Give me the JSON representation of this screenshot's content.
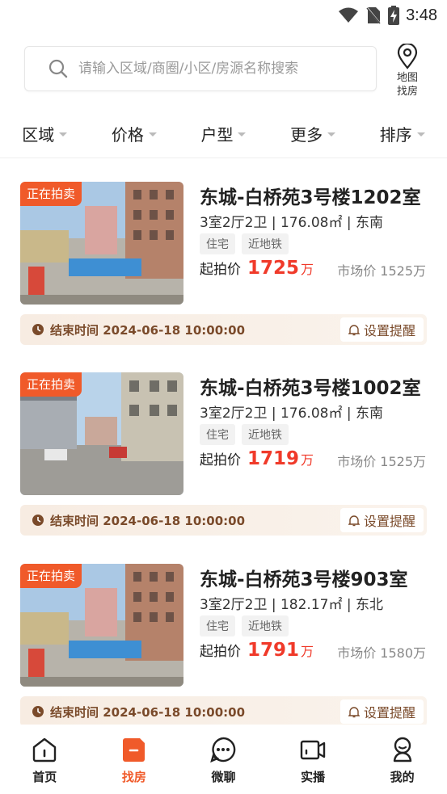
{
  "status_bar": {
    "time": "3:48"
  },
  "search": {
    "placeholder": "请输入区域/商圈/小区/房源名称搜索"
  },
  "map_search": {
    "line1": "地图",
    "line2": "找房"
  },
  "filters": [
    {
      "label": "区域"
    },
    {
      "label": "价格"
    },
    {
      "label": "户型"
    },
    {
      "label": "更多"
    },
    {
      "label": "排序"
    }
  ],
  "listings": [
    {
      "badge": "正在拍卖",
      "title": "东城-白桥苑3号楼1202室",
      "specs": "3室2厅2卫 | 176.08㎡ | 东南",
      "tags": [
        "住宅",
        "近地铁"
      ],
      "start_label": "起拍价",
      "start_price": "1725",
      "unit": "万",
      "market_price": "市场价 1525万",
      "end_time": "结束时间 2024-06-18 10:00:00",
      "remind": "设置提醒"
    },
    {
      "badge": "正在拍卖",
      "title": "东城-白桥苑3号楼1002室",
      "specs": "3室2厅2卫 | 176.08㎡ | 东南",
      "tags": [
        "住宅",
        "近地铁"
      ],
      "start_label": "起拍价",
      "start_price": "1719",
      "unit": "万",
      "market_price": "市场价 1525万",
      "end_time": "结束时间 2024-06-18 10:00:00",
      "remind": "设置提醒"
    },
    {
      "badge": "正在拍卖",
      "title": "东城-白桥苑3号楼903室",
      "specs": "3室2厅2卫 | 182.17㎡ | 东北",
      "tags": [
        "住宅",
        "近地铁"
      ],
      "start_label": "起拍价",
      "start_price": "1791",
      "unit": "万",
      "market_price": "市场价 1580万",
      "end_time": "结束时间 2024-06-18 10:00:00",
      "remind": "设置提醒"
    }
  ],
  "bottom_nav": [
    {
      "label": "首页",
      "icon": "home-icon"
    },
    {
      "label": "找房",
      "icon": "find-house-icon",
      "active": true
    },
    {
      "label": "微聊",
      "icon": "chat-icon"
    },
    {
      "label": "实播",
      "icon": "live-video-icon"
    },
    {
      "label": "我的",
      "icon": "profile-icon"
    }
  ],
  "colors": {
    "accent": "#f05a2a",
    "price": "#f03a2a",
    "end_bar_text": "#7a4a2a"
  }
}
